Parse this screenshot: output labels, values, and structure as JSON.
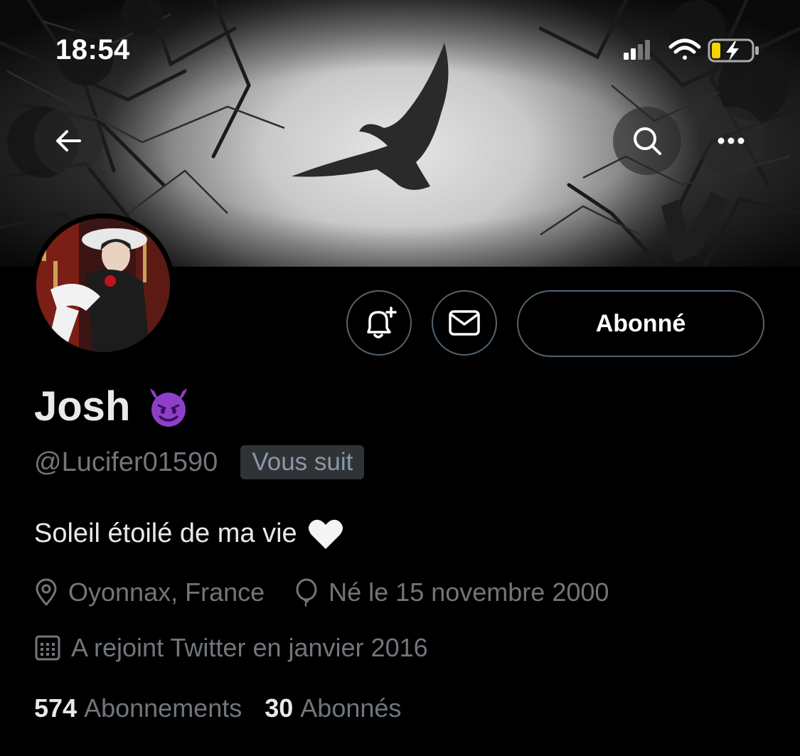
{
  "status_bar": {
    "time": "18:54",
    "icons": [
      "cellular-signal-icon",
      "wifi-icon",
      "battery-charging-icon"
    ]
  },
  "header": {
    "back_icon": "arrow-left-icon",
    "search_icon": "search-icon",
    "more_icon": "more-horizontal-icon"
  },
  "profile": {
    "display_name": "Josh",
    "name_emoji": "smiling-devil-emoji",
    "handle": "@Lucifer01590",
    "follows_you": "Vous suit",
    "bio": "Soleil étoilé de ma vie",
    "bio_emoji": "white-heart-emoji",
    "location": "Oyonnax, France",
    "birthday": "Né le 15 novembre 2000",
    "joined": "A rejoint Twitter en janvier 2016"
  },
  "actions": {
    "notifications_icon": "bell-plus-icon",
    "message_icon": "envelope-icon",
    "follow_label": "Abonné"
  },
  "stats": [
    {
      "count": "574",
      "label": "Abonnements"
    },
    {
      "count": "30",
      "label": "Abonnés"
    }
  ],
  "colors": {
    "background": "#000000",
    "primary_text": "#e7e9ea",
    "secondary_text": "#71767b",
    "border": "#536471",
    "badge_bg": "#2f3336",
    "emoji_purple": "#8e3fc7",
    "battery_yellow": "#f5d400"
  }
}
